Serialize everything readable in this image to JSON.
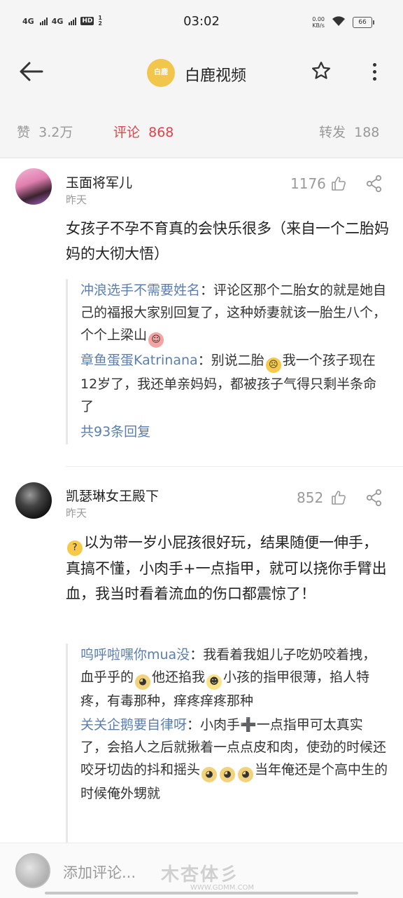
{
  "status_bar": {
    "net1": "4G",
    "net2": "4G",
    "hd": "HD",
    "hd_sub": "1 2",
    "time": "03:02",
    "speed_value": "0.00",
    "speed_unit": "KB/s",
    "battery": "66"
  },
  "header": {
    "logo_text": "白鹿",
    "title": "白鹿视频"
  },
  "stats": {
    "likes_label": "赞",
    "likes_value": "3.2万",
    "comments_label": "评论",
    "comments_value": "868",
    "reposts_label": "转发",
    "reposts_value": "188"
  },
  "colors": {
    "accent_red": "#e0434a",
    "reply_name_blue": "#5a7fae",
    "logo_yellow": "#f1c64a"
  },
  "comments": [
    {
      "username": "玉面将军儿",
      "time": "昨天",
      "likes": "1176",
      "text": "女孩子不孕不育真的会快乐很多（来自一个二胎妈妈的大彻大悟）",
      "replies": [
        {
          "name": "冲浪选手不需要姓名",
          "sep": "：",
          "text": "评论区那个二胎女的就是她自己的福报大家别回复了，这种娇妻就该一胎生八个，个个上梁山",
          "emoji": "blush-emoji"
        },
        {
          "name": "章鱼蛋蛋Katrinana",
          "sep": "：",
          "text_a": "别说二胎",
          "emoji": "crying-emoji",
          "text_b": "我一个孩子现在12岁了，我还单亲妈妈，都被孩子气得只剩半条命了"
        }
      ],
      "more_replies": "共93条回复"
    },
    {
      "username": "凯瑟琳女王殿下",
      "time": "昨天",
      "likes": "852",
      "emoji": "thinking-emoji",
      "text": "以为带一岁小屁孩很好玩，结果随便一伸手，真搞不懂，小肉手+一点指甲，就可以挠你手臂出血，我当时看着流血的伤口都震惊了！",
      "replies": [
        {
          "name": "呜呼啦嘿你mua没",
          "sep": "：",
          "text_a": "我看着我姐儿子吃奶咬着拽，血乎乎的",
          "emoji1": "doge-emoji",
          "text_b": "他还掐我",
          "emoji2": "mask-emoji",
          "text_c": "小孩的指甲很薄，掐人特疼，有毒那种，痒疼痒疼那种"
        },
        {
          "name": "关关企鹅要自律呀",
          "sep": "：",
          "text_a": "小肉手",
          "plus": "➕",
          "text_b": "一点指甲可太真实了，会掐人之后就揪着一点点皮和肉，使劲的时候还咬牙切齿的抖和摇头",
          "emoji1": "doge-emoji",
          "text_c": "当年俺还是个高中生的时候俺外甥就"
        }
      ]
    }
  ],
  "bottom_bar": {
    "placeholder": "添加评论...",
    "watermark": "木杏体彡",
    "watermark_url": "WWW.GDMM.COM"
  }
}
